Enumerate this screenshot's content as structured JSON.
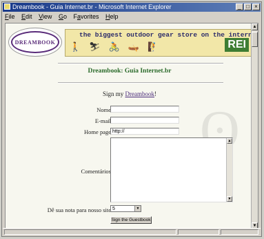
{
  "window": {
    "title": "Dreambook - Guia Internet.br - Microsoft Internet Explorer",
    "controls": [
      "_",
      "□",
      "×"
    ]
  },
  "menubar": {
    "items": [
      {
        "label": "File",
        "accel": "F",
        "rest": "ile"
      },
      {
        "label": "Edit",
        "accel": "E",
        "rest": "dit"
      },
      {
        "label": "View",
        "accel": "V",
        "rest": "iew"
      },
      {
        "label": "Go",
        "accel": "G",
        "rest": "o"
      },
      {
        "label": "Favorites",
        "accel": "a",
        "pre": "F",
        "rest": "vorites"
      },
      {
        "label": "Help",
        "accel": "H",
        "rest": "elp"
      }
    ]
  },
  "logo": {
    "text": "DREAMBOOK"
  },
  "banner": {
    "text": "the biggest outdoor gear store on the internet",
    "brand": "REI"
  },
  "page": {
    "title": "Dreambook: Guia Internet.br",
    "sign_prefix": "Sign my ",
    "sign_link": "Dreambook",
    "sign_suffix": "!"
  },
  "form": {
    "name_label": "Nome",
    "email_label": "E-mail",
    "homepage_label": "Home page",
    "homepage_value": "http://",
    "comments_label": "Comentários",
    "rating_label": "Dê sua nota para nosso site",
    "rating_value": "5",
    "submit_label": "Sign the Guestbook"
  },
  "colors": {
    "title_green": "#2a6a2a",
    "link_purple": "#4a2a7a",
    "titlebar_blue": "#1a3a8a"
  }
}
